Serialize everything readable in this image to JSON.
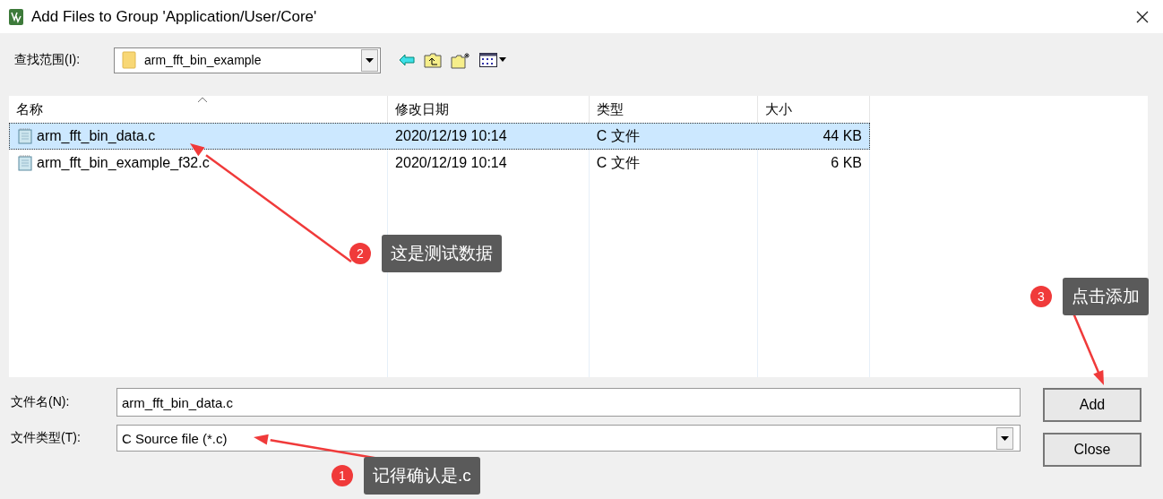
{
  "window": {
    "title": "Add Files to Group 'Application/User/Core'"
  },
  "look_in": {
    "label": "查找范围(I):",
    "value": "arm_fft_bin_example"
  },
  "file_list": {
    "columns": [
      {
        "label": "名称",
        "sorted": true
      },
      {
        "label": "修改日期",
        "sorted": false
      },
      {
        "label": "类型",
        "sorted": false
      },
      {
        "label": "大小",
        "sorted": false
      }
    ],
    "rows": [
      {
        "name": "arm_fft_bin_data.c",
        "modified": "2020/12/19 10:14",
        "type": "C 文件",
        "size": "44 KB",
        "selected": true
      },
      {
        "name": "arm_fft_bin_example_f32.c",
        "modified": "2020/12/19 10:14",
        "type": "C 文件",
        "size": "6 KB",
        "selected": false
      }
    ]
  },
  "file_name": {
    "label": "文件名(N):",
    "value": "arm_fft_bin_data.c"
  },
  "file_type": {
    "label": "文件类型(T):",
    "value": "C Source file (*.c)"
  },
  "buttons": [
    "Add",
    "Close"
  ],
  "annotations": [
    {
      "number": "2",
      "text": "这是测试数据"
    },
    {
      "number": "3",
      "text": "点击添加"
    },
    {
      "number": "1",
      "text": "记得确认是.c"
    }
  ]
}
